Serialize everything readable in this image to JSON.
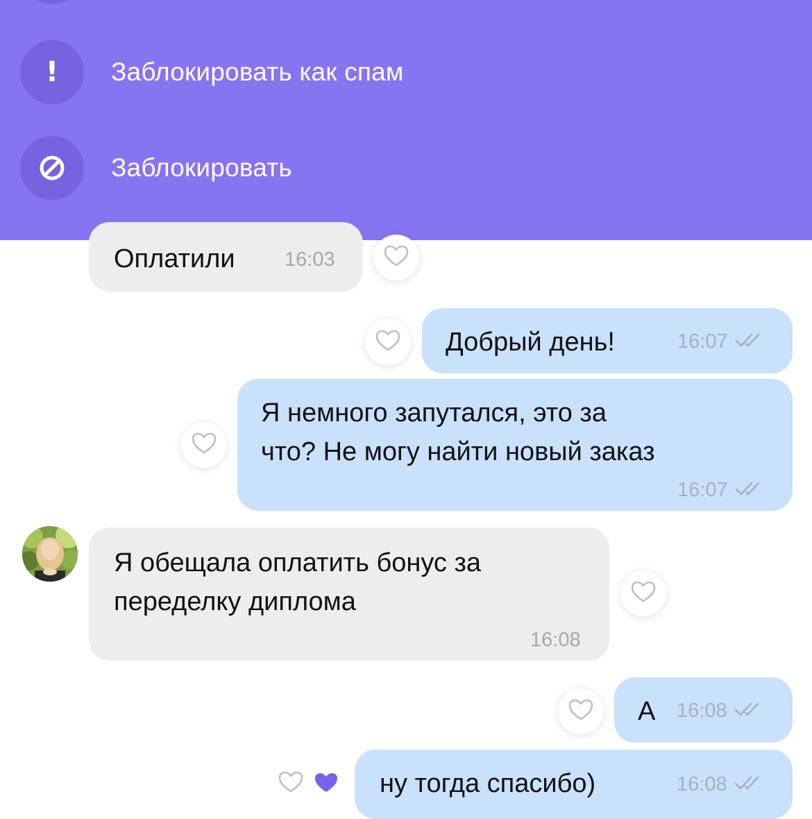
{
  "menu": {
    "items": [
      {
        "label": "Заблокировать как спам",
        "icon": "exclamation-icon",
        "icon_glyph": "!"
      },
      {
        "label": "Заблокировать",
        "icon": "block-icon"
      }
    ],
    "background": "#8675f1",
    "icon_background": "#7563e0"
  },
  "messages": [
    {
      "direction": "incoming",
      "text": "Оплатили",
      "time": "16:03"
    },
    {
      "direction": "outgoing",
      "text": "Добрый день!",
      "time": "16:07",
      "status": "read"
    },
    {
      "direction": "outgoing",
      "lines": [
        "Я немного запутался, это за",
        "что? Не могу найти новый заказ"
      ],
      "time": "16:07",
      "status": "read"
    },
    {
      "direction": "incoming",
      "lines": [
        "Я обещала оплатить бонус за",
        "переделку диплома"
      ],
      "time": "16:08"
    },
    {
      "direction": "outgoing",
      "text": "А",
      "time": "16:08",
      "status": "read"
    },
    {
      "direction": "outgoing",
      "text": "ну тогда спасибо)",
      "time": "16:08",
      "status": "read",
      "reaction": "purple-heart"
    }
  ],
  "colors": {
    "incoming_bubble": "#ededed",
    "outgoing_bubble": "#c9e1fb",
    "reaction": "#7b61f0"
  }
}
